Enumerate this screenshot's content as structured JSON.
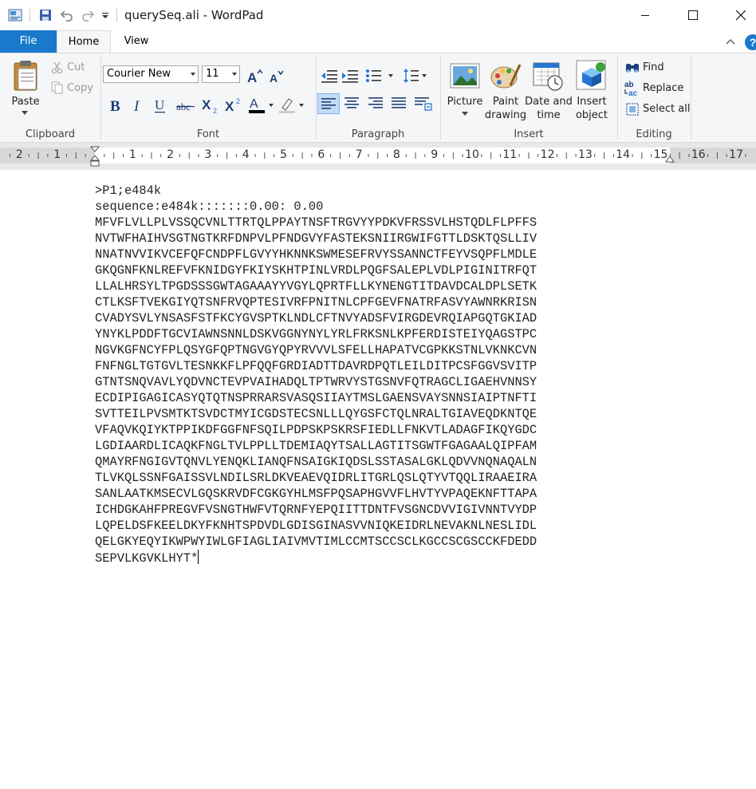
{
  "window": {
    "title": "querySeq.ali - WordPad"
  },
  "tabs": {
    "file": "File",
    "home": "Home",
    "view": "View"
  },
  "ribbon": {
    "clipboard": {
      "group_label": "Clipboard",
      "paste": "Paste",
      "cut": "Cut",
      "copy": "Copy"
    },
    "font": {
      "group_label": "Font",
      "font_name": "Courier New",
      "font_size": "11"
    },
    "paragraph": {
      "group_label": "Paragraph"
    },
    "insert": {
      "group_label": "Insert",
      "picture": "Picture",
      "paint_line1": "Paint",
      "paint_line2": "drawing",
      "datetime_line1": "Date and",
      "datetime_line2": "time",
      "object_line1": "Insert",
      "object_line2": "object"
    },
    "editing": {
      "group_label": "Editing",
      "find": "Find",
      "replace": "Replace",
      "select_all": "Select all"
    }
  },
  "ruler": {
    "labels": [
      "2",
      "1",
      "1",
      "2",
      "3",
      "4",
      "5",
      "6",
      "7",
      "8",
      "9",
      "10",
      "11",
      "12",
      "13",
      "14",
      "15",
      "16",
      "17"
    ]
  },
  "document": {
    "lines": [
      ">P1;e484k",
      "sequence:e484k:::::::0.00: 0.00",
      "MFVFLVLLPLVSSQCVNLTTRTQLPPAYTNSFTRGVYYPDKVFRSSVLHSTQDLFLPFFS",
      "NVTWFHAIHVSGTNGTKRFDNPVLPFNDGVYFASTEKSNIIRGWIFGTTLDSKTQSLLIV",
      "NNATNVVIKVCEFQFCNDPFLGVYYHKNNKSWMESEFRVYSSANNCTFEYVSQPFLMDLE",
      "GKQGNFKNLREFVFKNIDGYFKIYSKHTPINLVRDLPQGFSALEPLVDLPIGINITRFQT",
      "LLALHRSYLTPGDSSSGWTAGAAAYYVGYLQPRTFLLKYNENGTITDAVDCALDPLSETK",
      "CTLKSFTVEKGIYQTSNFRVQPTESIVRFPNITNLCPFGEVFNATRFASVYAWNRKRISN",
      "CVADYSVLYNSASFSTFKCYGVSPTKLNDLCFTNVYADSFVIRGDEVRQIAPGQTGKIAD",
      "YNYKLPDDFTGCVIAWNSNNLDSKVGGNYNYLYRLFRKSNLKPFERDISTEIYQAGSTPC",
      "NGVKGFNCYFPLQSYGFQPTNGVGYQPYRVVVLSFELLHAPATVCGPKKSTNLVKNKCVN",
      "FNFNGLTGTGVLTESNKKFLPFQQFGRDIADTTDAVRDPQTLEILDITPCSFGGVSVITP",
      "GTNTSNQVAVLYQDVNCTEVPVAIHADQLTPTWRVYSTGSNVFQTRAGCLIGAEHVNNSY",
      "ECDIPIGAGICASYQTQTNSPRRARSVASQSIIAYTMSLGAENSVAYSNNSIAIPTNFTI",
      "SVTTEILPVSMTKTSVDCTMYICGDSTECSNLLLQYGSFCTQLNRALTGIAVEQDKNTQE",
      "VFAQVKQIYKTPPIKDFGGFNFSQILPDPSKPSKRSFIEDLLFNKVTLADAGFIKQYGDC",
      "LGDIAARDLICAQKFNGLTVLPPLLTDEMIAQYTSALLAGTITSGWTFGAGAALQIPFAM",
      "QMAYRFNGIGVTQNVLYENQKLIANQFNSAIGKIQDSLSSTASALGKLQDVVNQNAQALN",
      "TLVKQLSSNFGAISSVLNDILSRLDKVEAEVQIDRLITGRLQSLQTYVTQQLIRAAEIRA",
      "SANLAATKMSECVLGQSKRVDFCGKGYHLMSFPQSAPHGVVFLHVTYVPAQEKNFTTAPA",
      "ICHDGKAHFPREGVFVSNGTHWFVTQRNFYEPQIITTDNTFVSGNCDVVIGIVNNTVYDP",
      "LQPELDSFKEELDKYFKNHTSPDVDLGDISGINASVVNIQKEIDRLNEVAKNLNESLIDL",
      "QELGKYEQYIKWPWYIWLGFIAGLIAIVMVTIMLCCMTSCCSCLKGCCSCGSCCKFDEDD",
      "SEPVLKGVKLHYT*"
    ]
  },
  "colors": {
    "accent": "#1979ca",
    "ribbon_bg": "#f5f6f7",
    "ruler_bg": "#e7e8e9"
  }
}
